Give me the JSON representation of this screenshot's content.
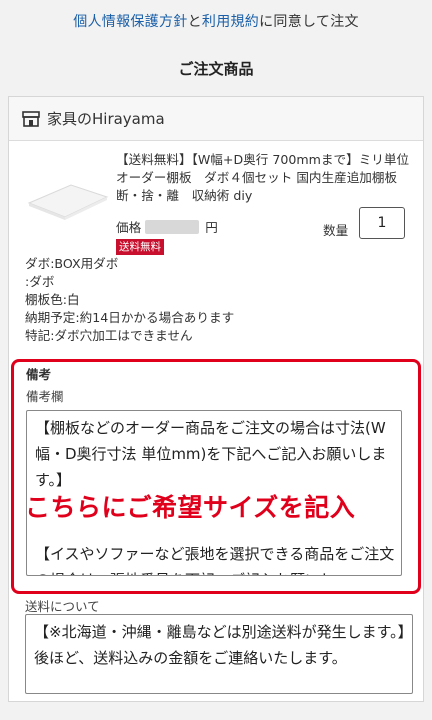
{
  "consent": {
    "privacy_link": "個人情報保護方針",
    "and": "と",
    "terms_link": "利用規約",
    "suffix": "に同意して注文"
  },
  "section_title": "ご注文商品",
  "shop": {
    "name": "家具のHirayama",
    "icon": "shop-icon"
  },
  "product": {
    "name": "【送料無料】【W幅+D奥行 700mmまで】ミリ単位オーダー棚板　ダボ４個セット 国内生産追加棚板 断・捨・離　収納術 diy",
    "price_label": "価格",
    "price_unit": "円",
    "shipping_badge": "送料無料",
    "quantity_label": "数量",
    "quantity_value": "1"
  },
  "options": [
    "ダボ:BOX用ダボ",
    ":ダボ",
    "棚板色:白",
    "納期予定:約14日かかる場合あります",
    "特記:ダボ穴加工はできません"
  ],
  "remarks": {
    "title": "備考",
    "field_label": "備考欄",
    "text_p1": "【棚板などのオーダー商品をご注文の場合は寸法(W幅・D奥行寸法 単位mm)を下記へご記入お願いします。】",
    "text_p2": "【イスやソファーなど張地を選択できる商品をご注文の場合は、張地番号を下記へご記入お願いし",
    "overlay": "こちらにご希望サイズを記入"
  },
  "shipping": {
    "label": "送料について",
    "text": "【※北海道・沖縄・離島などは別途送料が発生します。】後ほど、送料込みの金額をご連絡いたします。"
  },
  "colors": {
    "link": "#1a5fa8",
    "highlight_red": "#e0001b",
    "badge_red": "#c8102e"
  }
}
